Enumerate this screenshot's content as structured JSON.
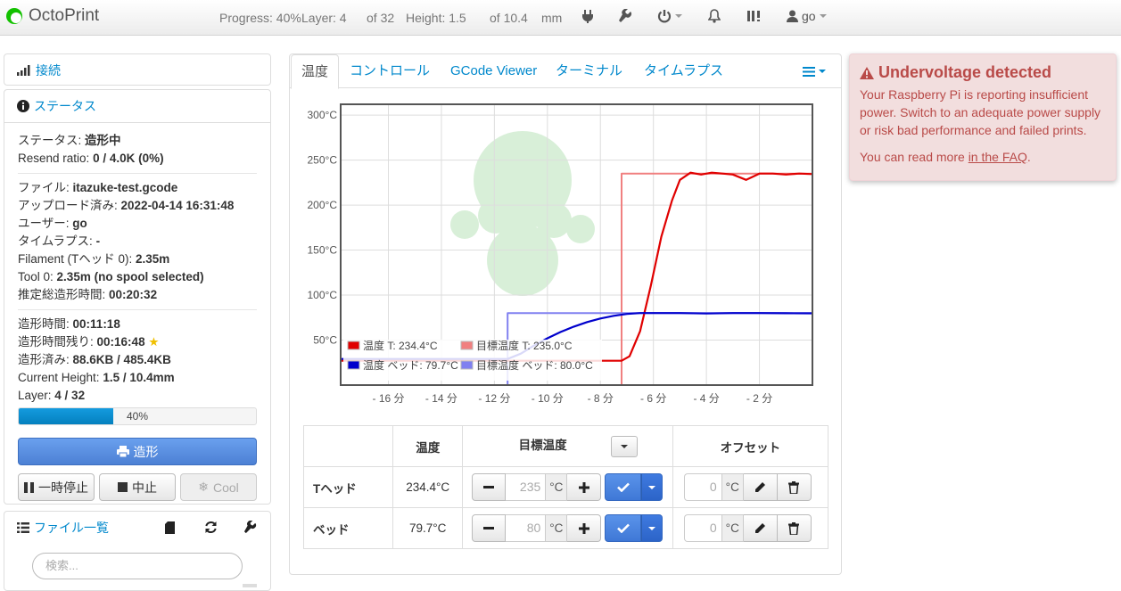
{
  "navbar": {
    "brand": "OctoPrint",
    "progress": "Progress: 40%",
    "layer": "Layer: 4",
    "layer_total": "of 32",
    "height": "Height: 1.5",
    "height_total": "of 10.4",
    "height_unit": "mm",
    "user": "go"
  },
  "sidebar": {
    "connection_title": "接続",
    "status_title": "ステータス",
    "status": {
      "label": "ステータス:",
      "value": "造形中"
    },
    "resend": {
      "label": "Resend ratio:",
      "value": "0 / 4.0K (0%)"
    },
    "file": {
      "label": "ファイル:",
      "value": "itazuke-test.gcode"
    },
    "uploaded": {
      "label": "アップロード済み:",
      "value": "2022-04-14 16:31:48"
    },
    "user": {
      "label": "ユーザー:",
      "value": "go"
    },
    "timelapse": {
      "label": "タイムラプス:",
      "value": "-"
    },
    "filament": {
      "label": "Filament (Tヘッド 0):",
      "value": "2.35m"
    },
    "tool0": {
      "label": "Tool 0:",
      "value": "2.35m (no spool selected)"
    },
    "estimated": {
      "label": "推定総造形時間:",
      "value": "00:20:32"
    },
    "print_time": {
      "label": "造形時間:",
      "value": "00:11:18"
    },
    "time_left": {
      "label": "造形時間残り:",
      "value": "00:16:48"
    },
    "printed": {
      "label": "造形済み:",
      "value": "88.6KB / 485.4KB"
    },
    "current_height": {
      "label": "Current Height:",
      "value": "1.5 / 10.4mm"
    },
    "layer": {
      "label": "Layer:",
      "value": "4 / 32"
    },
    "progress": {
      "value": 40,
      "label": "40%"
    },
    "print_button": "造形",
    "pause_button": "一時停止",
    "cancel_button": "中止",
    "cool_button": "Cool",
    "files_title": "ファイル一覧",
    "search_placeholder": "検索..."
  },
  "tabs": [
    "温度",
    "コントロール",
    "GCode Viewer",
    "ターミナル",
    "タイムラプス"
  ],
  "chart_data": {
    "type": "line",
    "xlabel": "",
    "ylabel": "",
    "x_tick_labels": [
      "- 16 分",
      "- 14 分",
      "- 12 分",
      "- 10 分",
      "- 8 分",
      "- 6 分",
      "- 4 分",
      "- 2 分"
    ],
    "y_tick_labels": [
      "50°C",
      "100°C",
      "150°C",
      "200°C",
      "250°C",
      "300°C"
    ],
    "xlim": [
      -17.8,
      0
    ],
    "ylim": [
      0,
      312
    ],
    "grid": true,
    "legend_position": "bottom-left",
    "series": [
      {
        "name": "温度 T: 234.4°C",
        "color": "#e00000",
        "x": [
          -17.8,
          -7.2,
          -6.9,
          -6.5,
          -6.1,
          -5.7,
          -5.3,
          -5.0,
          -4.6,
          -4.2,
          -3.8,
          -3.4,
          -3.0,
          -2.5,
          -2.0,
          -1.5,
          -1.0,
          -0.5,
          0
        ],
        "y": [
          27,
          27,
          32,
          60,
          110,
          165,
          205,
          228,
          236,
          234,
          236,
          235,
          234,
          228,
          235,
          235,
          234,
          235,
          234.4
        ]
      },
      {
        "name": "目標温度 T: 235.0°C",
        "color": "#f08080",
        "x": [
          -17.8,
          -7.2,
          -7.2,
          0
        ],
        "y": [
          0,
          0,
          235,
          235
        ]
      },
      {
        "name": "温度 ベッド: 79.7°C",
        "color": "#0000cc",
        "x": [
          -17.8,
          -11.5,
          -11.0,
          -10.5,
          -10.0,
          -9.5,
          -9.0,
          -8.5,
          -8.0,
          -7.5,
          -7.0,
          -6.5,
          -6.0,
          -5.0,
          -4.0,
          -3.0,
          -2.0,
          -1.0,
          0
        ],
        "y": [
          29,
          29,
          35,
          44,
          52,
          59,
          65,
          70,
          74,
          77,
          79,
          80,
          80,
          80,
          79.5,
          80,
          80,
          79.8,
          79.7
        ]
      },
      {
        "name": "目標温度 ベッド: 80.0°C",
        "color": "#8080f0",
        "x": [
          -17.8,
          -11.5,
          -11.5,
          0
        ],
        "y": [
          0,
          0,
          80,
          80
        ]
      }
    ]
  },
  "temp_table": {
    "headers": [
      "温度",
      "目標温度",
      "オフセット"
    ],
    "rows": [
      {
        "name": "Tヘッド",
        "actual": "234.4°C",
        "target": "235",
        "unit": "°C",
        "offset": "0",
        "offset_unit": "°C"
      },
      {
        "name": "ベッド",
        "actual": "79.7°C",
        "target": "80",
        "unit": "°C",
        "offset": "0",
        "offset_unit": "°C"
      }
    ]
  },
  "alert": {
    "title": "Undervoltage detected",
    "text": "Your Raspberry Pi is reporting insufficient power. Switch to an adequate power supply or risk bad performance and failed prints.",
    "more_prefix": "You can read more ",
    "more_link": "in the FAQ",
    "more_suffix": "."
  },
  "colors": {
    "link": "#0088cc",
    "print_button": "#4c80d4",
    "alert_bg": "#f2dede",
    "alert_text": "#b94a48"
  }
}
